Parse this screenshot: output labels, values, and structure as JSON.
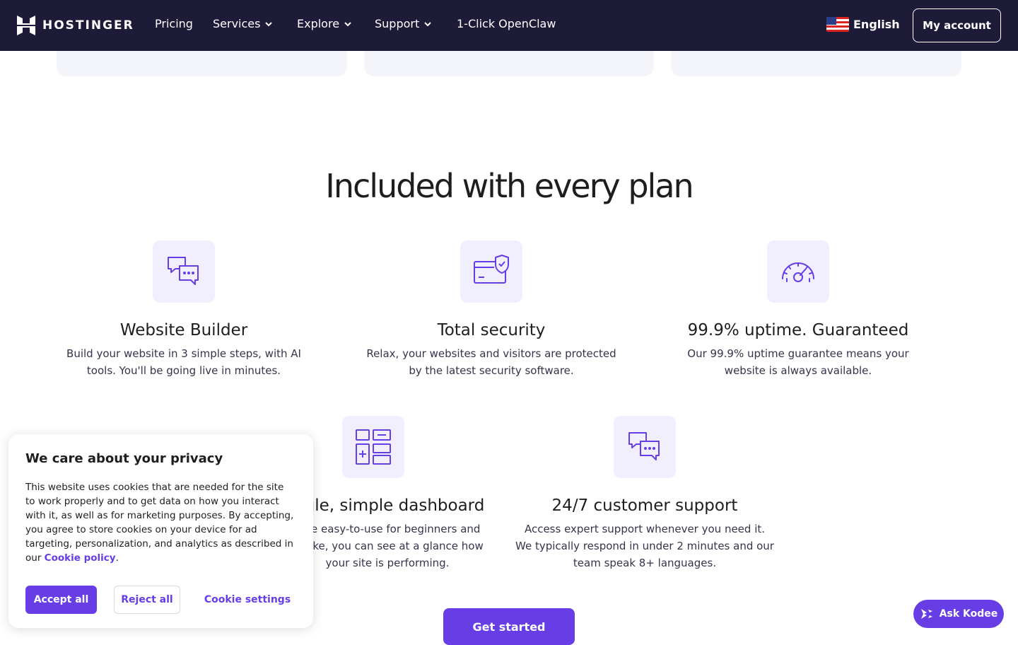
{
  "nav": {
    "brand": "HOSTINGER",
    "items": [
      {
        "label": "Pricing",
        "has_dropdown": false
      },
      {
        "label": "Services",
        "has_dropdown": true
      },
      {
        "label": "Explore",
        "has_dropdown": true
      },
      {
        "label": "Support",
        "has_dropdown": true
      },
      {
        "label": "1-Click OpenClaw",
        "has_dropdown": false
      }
    ],
    "language": "English",
    "account_button": "My account"
  },
  "section": {
    "title": "Included with every plan"
  },
  "features": [
    {
      "icon": "chat-bubbles-icon",
      "title": "Website Builder",
      "desc_lines": [
        "Build your website in 3 simple steps, with AI",
        "tools. You'll be going live in minutes."
      ]
    },
    {
      "icon": "security-card-shield-icon",
      "title": "Total security",
      "desc_lines": [
        "Relax, your websites and visitors are protected",
        "by the latest security software."
      ]
    },
    {
      "icon": "speedometer-icon",
      "title": "99.9% uptime. Guaranteed",
      "desc_lines": [
        "Our 99.9% uptime guarantee means your",
        "website is always available."
      ]
    },
    {
      "icon": "dashboard-grid-icon",
      "title": "gle, simple dashboard",
      "desc_lines": [
        "o be easy-to-use for beginners and",
        "s alike, you can see at a glance how",
        "your site is performing."
      ]
    },
    {
      "icon": "chat-bubbles-icon",
      "title": "24/7 customer support",
      "desc_lines": [
        "Access expert support whenever you need it.",
        "We typically respond in under 2 minutes and our",
        "team speak 8+ languages."
      ]
    }
  ],
  "cta": "Get started",
  "cookie": {
    "title": "We care about your privacy",
    "body": "This website uses cookies that are needed for the site to work properly and to get data on how you interact with it, as well as for marketing purposes. By accepting, you agree to store cookies on your device for ad targeting, personalization, and analytics as described in our",
    "policy_link": "Cookie policy",
    "policy_suffix": ".",
    "accept": "Accept all",
    "reject": "Reject all",
    "settings": "Cookie settings"
  },
  "assistant": {
    "label": "Ask Kodee"
  },
  "colors": {
    "nav_bg": "#1d1b38",
    "accent": "#673de6",
    "icon_bg": "#f1eefe"
  }
}
